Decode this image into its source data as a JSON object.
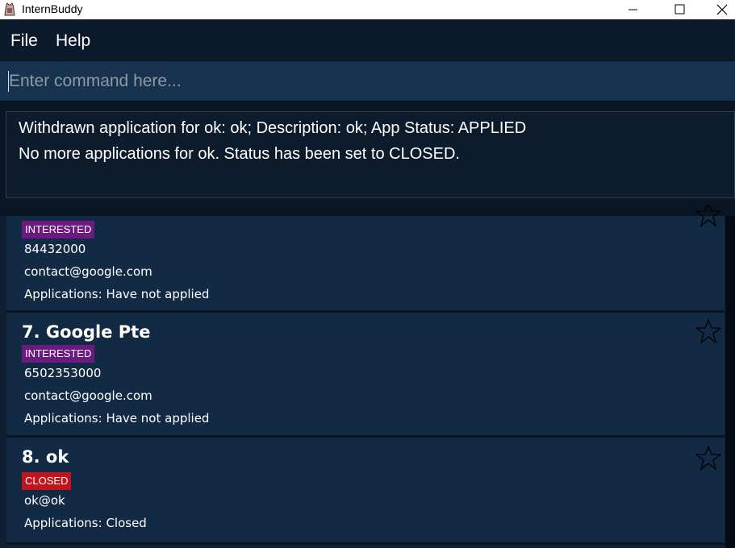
{
  "window": {
    "title": "InternBuddy"
  },
  "menu": {
    "file": "File",
    "help": "Help"
  },
  "command": {
    "placeholder": "Enter command here..."
  },
  "result": {
    "line1": "Withdrawn application for ok: ok; Description: ok; App Status: APPLIED",
    "line2": "No more applications for ok. Status has been set to CLOSED."
  },
  "companies": [
    {
      "tag": "INTERESTED",
      "phone": "84432000",
      "email": "contact@google.com",
      "applications": "Applications: Have not applied"
    },
    {
      "name": "7. Google Pte",
      "tag": "INTERESTED",
      "phone": "6502353000",
      "email": "contact@google.com",
      "applications": "Applications: Have not applied"
    },
    {
      "name": "8. ok",
      "tag": "CLOSED",
      "email": "ok@ok",
      "applications": "Applications: Closed"
    }
  ],
  "colors": {
    "interested_tag": "#6d1a80",
    "closed_tag": "#c0151d",
    "card_bg": "#132a45",
    "background": "#0c1a2b"
  },
  "icons": {
    "favorite": "star-outline-icon",
    "minimize": "minimize-icon",
    "maximize": "maximize-icon",
    "close": "close-icon",
    "app": "app-icon"
  }
}
